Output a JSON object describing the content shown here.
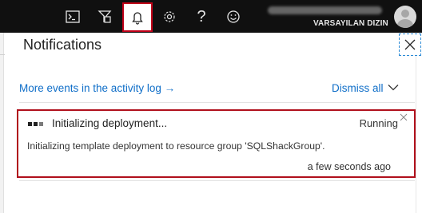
{
  "topbar": {
    "icons": [
      "cloud-shell-icon",
      "directory-filter-icon",
      "bell-icon",
      "gear-icon",
      "help-icon",
      "smiley-icon"
    ],
    "help_glyph": "?",
    "user_directory": "VARSAYILAN DIZIN"
  },
  "panel": {
    "title": "Notifications",
    "activity_link": "More events in the activity log →",
    "dismiss_all": "Dismiss all"
  },
  "notification": {
    "title": "Initializing deployment...",
    "status": "Running",
    "description": "Initializing template deployment to resource group 'SQLShackGroup'.",
    "time": "a few seconds ago"
  },
  "colors": {
    "topbar_bg": "#101010",
    "highlight_border": "#c00018",
    "link": "#0f6ec8"
  }
}
